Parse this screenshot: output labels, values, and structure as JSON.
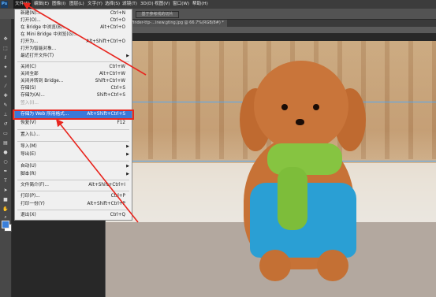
{
  "menubar": {
    "items": [
      "文件(F)",
      "编辑(E)",
      "图像(I)",
      "图层(L)",
      "文字(Y)",
      "选择(S)",
      "滤镜(T)",
      "3D(D)",
      "视图(V)",
      "窗口(W)",
      "帮助(H)"
    ]
  },
  "optbar": {
    "button": "基于参考线的切片"
  },
  "document": {
    "tab": "gfinder-ttp-...inew.gting.jpg @ 66.7%(RGB/8#) *"
  },
  "file_menu": [
    {
      "label": "新建(N)...",
      "shortcut": "Ctrl+N"
    },
    {
      "label": "打开(O)...",
      "shortcut": "Ctrl+O"
    },
    {
      "label": "在 Bridge 中浏览(B)...",
      "shortcut": "Alt+Ctrl+O"
    },
    {
      "label": "在 Mini Bridge 中浏览(G)...",
      "shortcut": ""
    },
    {
      "label": "打开为...",
      "shortcut": "Alt+Shift+Ctrl+O"
    },
    {
      "label": "打开为智能对象...",
      "shortcut": ""
    },
    {
      "label": "最近打开文件(T)",
      "shortcut": "",
      "submenu": true
    },
    {
      "label": "关闭(C)",
      "shortcut": "Ctrl+W"
    },
    {
      "label": "关闭全部",
      "shortcut": "Alt+Ctrl+W"
    },
    {
      "label": "关闭并转到 Bridge...",
      "shortcut": "Shift+Ctrl+W"
    },
    {
      "label": "存储(S)",
      "shortcut": "Ctrl+S"
    },
    {
      "label": "存储为(A)...",
      "shortcut": "Shift+Ctrl+S"
    },
    {
      "label": "签入(I)...",
      "shortcut": "",
      "disabled": true
    },
    {
      "label": "存储为 Web 所用格式...",
      "shortcut": "Alt+Shift+Ctrl+S",
      "highlighted": true
    },
    {
      "label": "恢复(V)",
      "shortcut": "F12"
    },
    {
      "label": "置入(L)...",
      "shortcut": ""
    },
    {
      "label": "导入(M)",
      "shortcut": "",
      "submenu": true
    },
    {
      "label": "导出(E)",
      "shortcut": "",
      "submenu": true
    },
    {
      "label": "自动(U)",
      "shortcut": "",
      "submenu": true
    },
    {
      "label": "脚本(R)",
      "shortcut": "",
      "submenu": true
    },
    {
      "label": "文件简介(F)...",
      "shortcut": "Alt+Shift+Ctrl+I"
    },
    {
      "label": "打印(P)...",
      "shortcut": "Ctrl+P"
    },
    {
      "label": "打印一份(Y)",
      "shortcut": "Alt+Shift+Ctrl+P"
    },
    {
      "label": "退出(X)",
      "shortcut": "Ctrl+Q"
    }
  ],
  "colors": {
    "highlight": "#3b78d8",
    "annotation": "#e8261f",
    "foreground_swatch": "#3a7fd9",
    "background_swatch": "#ffffff"
  },
  "icons": [
    "photoshop-logo",
    "move-icon",
    "marquee-icon",
    "lasso-icon",
    "magic-wand-icon",
    "crop-icon",
    "eyedropper-icon",
    "healing-brush-icon",
    "brush-icon",
    "clone-stamp-icon",
    "history-brush-icon",
    "eraser-icon",
    "gradient-icon",
    "blur-icon",
    "dodge-icon",
    "pen-icon",
    "type-icon",
    "path-selection-icon",
    "shape-icon",
    "hand-icon",
    "zoom-icon"
  ]
}
